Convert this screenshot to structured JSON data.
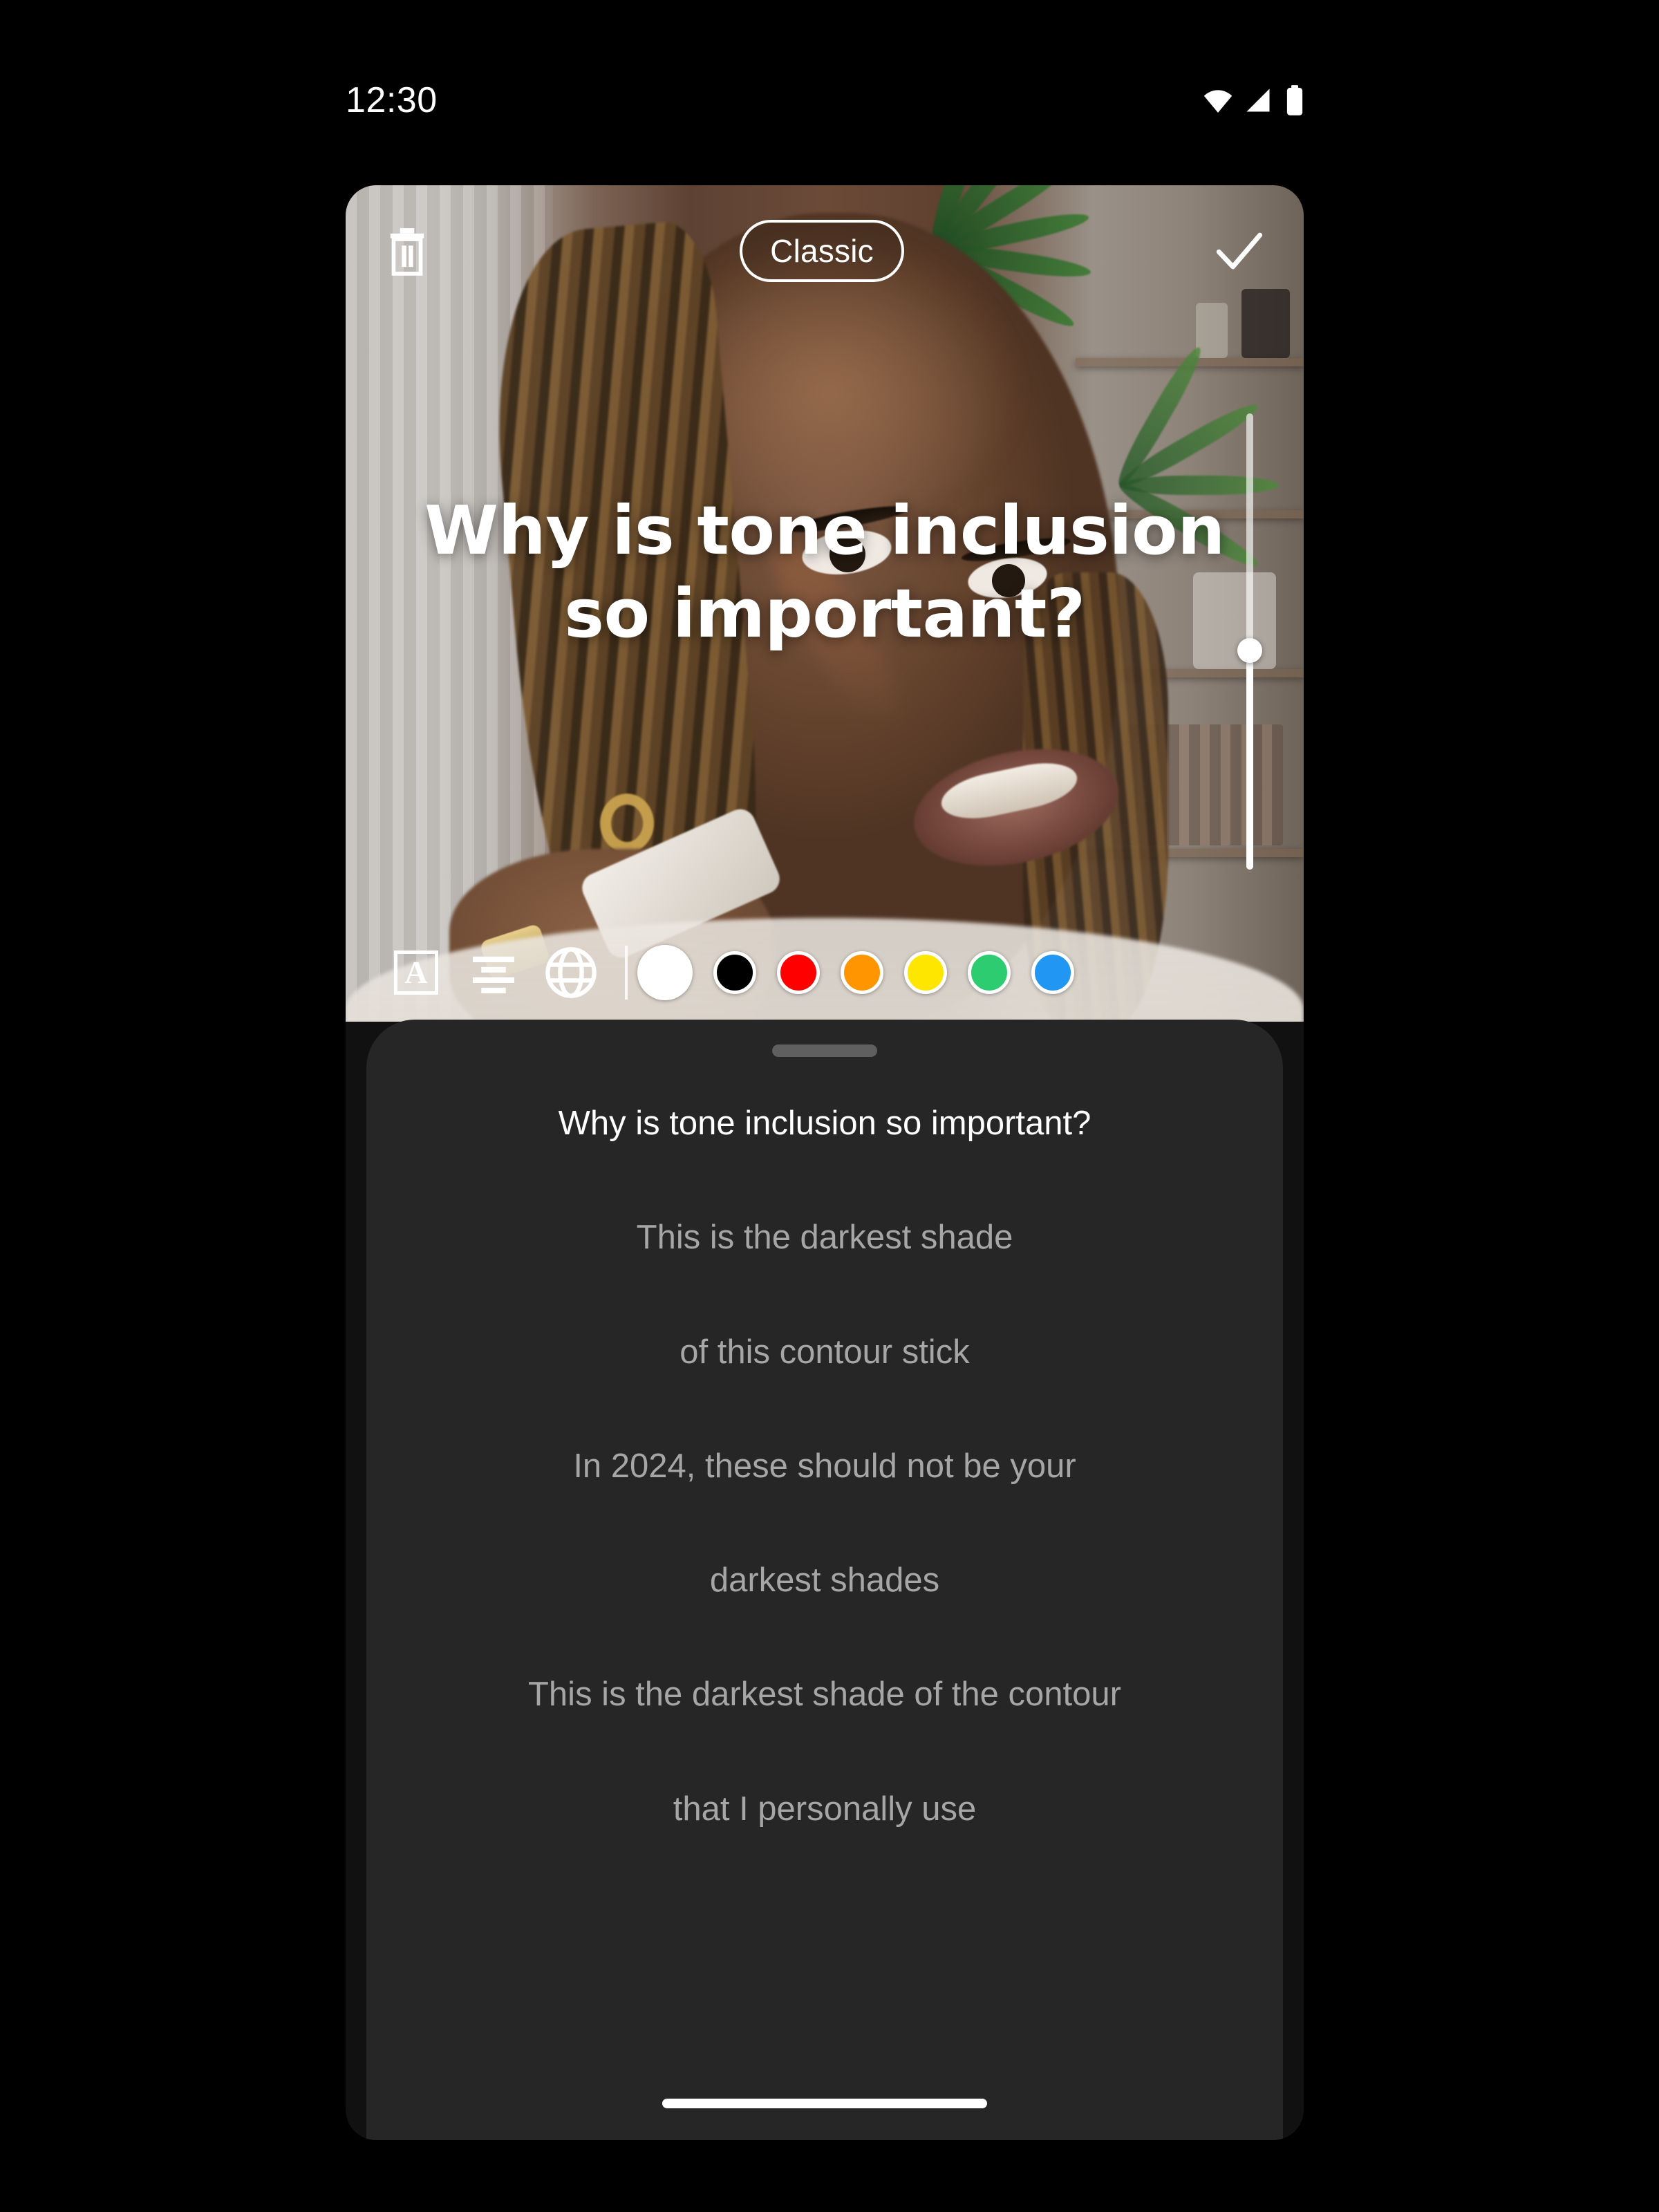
{
  "status_bar": {
    "time": "12:30",
    "icons": [
      "wifi-icon",
      "cellular-signal-icon",
      "battery-icon"
    ]
  },
  "editor": {
    "delete_icon": "trash-icon",
    "style_label": "Classic",
    "confirm_icon": "check-icon",
    "overlay_caption": "Why is tone inclusion so important?",
    "size_slider": {
      "value_percent": 48,
      "orientation": "vertical"
    },
    "tools": [
      {
        "name": "text-style-tool",
        "glyph": "A"
      },
      {
        "name": "text-align-tool",
        "glyph": "align-center-icon"
      },
      {
        "name": "language-tool",
        "glyph": "globe-icon"
      }
    ],
    "colors": [
      {
        "name": "white",
        "hex": "#FFFFFF",
        "selected": true
      },
      {
        "name": "black",
        "hex": "#000000",
        "selected": false
      },
      {
        "name": "red",
        "hex": "#FF0000",
        "selected": false
      },
      {
        "name": "orange",
        "hex": "#FF9500",
        "selected": false
      },
      {
        "name": "yellow",
        "hex": "#FFE600",
        "selected": false
      },
      {
        "name": "green",
        "hex": "#2ECC71",
        "selected": false
      },
      {
        "name": "blue",
        "hex": "#2196F3",
        "selected": false
      }
    ]
  },
  "transcript_sheet": {
    "handle": "drag-handle",
    "lines": [
      {
        "text": "Why is tone inclusion so important?",
        "active": true
      },
      {
        "text": "This is the darkest shade",
        "active": false
      },
      {
        "text": "of this contour stick",
        "active": false
      },
      {
        "text": "In 2024, these should not be your",
        "active": false
      },
      {
        "text": "darkest shades",
        "active": false
      },
      {
        "text": "This is the darkest shade of the contour",
        "active": false
      },
      {
        "text": "that I personally use",
        "active": false
      }
    ]
  },
  "system": {
    "home_indicator": "home-indicator"
  }
}
